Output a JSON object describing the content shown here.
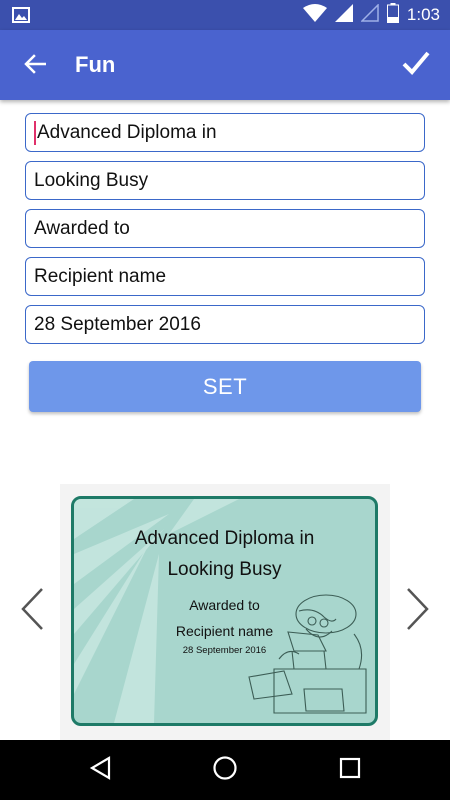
{
  "status_bar": {
    "time": "1:03",
    "icons": [
      "gallery-notification-icon",
      "wifi-icon",
      "signal-icon",
      "no-signal-icon",
      "battery-icon"
    ]
  },
  "app_bar": {
    "title": "Fun",
    "back_icon": "arrow-left-icon",
    "confirm_icon": "checkmark-icon",
    "color": "#4a63cf"
  },
  "form": {
    "line1": "Advanced Diploma in",
    "line2": "Looking Busy",
    "line3": "Awarded to",
    "line4": "Recipient name",
    "line5": "28 September 2016",
    "set_label": "SET",
    "field_border_color": "#3b68c9",
    "set_button_color": "#6e97ea"
  },
  "certificate": {
    "title_line1": "Advanced Diploma in",
    "title_line2": "Looking Busy",
    "awarded_to": "Awarded to",
    "recipient": "Recipient name",
    "date": "28 September 2016",
    "background_color": "#a8d6cd",
    "border_color": "#1e7a67"
  },
  "carousel": {
    "prev_icon": "chevron-left-icon",
    "next_icon": "chevron-right-icon"
  },
  "system_nav": {
    "buttons": [
      "back-triangle-icon",
      "home-circle-icon",
      "recents-square-icon"
    ]
  }
}
